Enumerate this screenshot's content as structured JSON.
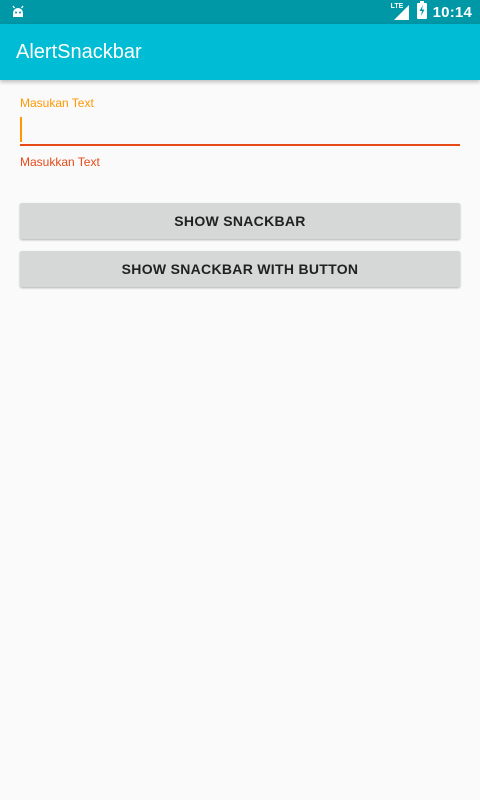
{
  "status_bar": {
    "time": "10:14",
    "network_label": "LTE",
    "icons": [
      "android-notification-icon",
      "lte-signal-icon",
      "battery-charging-icon"
    ]
  },
  "app_bar": {
    "title": "AlertSnackbar",
    "color": "#00bcd4",
    "status_color": "#0097a7"
  },
  "form": {
    "label": "Masukan Text",
    "value": "",
    "error": "Masukkan Text",
    "label_color": "#ff9800",
    "error_color": "#e64a19"
  },
  "buttons": {
    "show_snackbar": "SHOW SNACKBAR",
    "show_snackbar_with_button": "SHOW SNACKBAR WITH BUTTON"
  }
}
